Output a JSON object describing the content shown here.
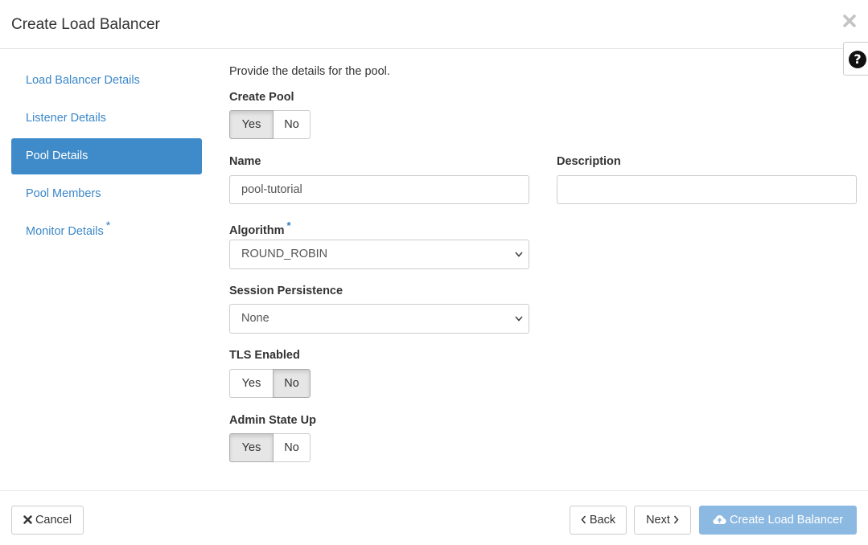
{
  "header": {
    "title": "Create Load Balancer",
    "close_icon": "close-icon",
    "help_icon": "question-circle-icon"
  },
  "sidebar": {
    "items": [
      {
        "label": "Load Balancer Details",
        "active": false,
        "required": false
      },
      {
        "label": "Listener Details",
        "active": false,
        "required": false
      },
      {
        "label": "Pool Details",
        "active": true,
        "required": false
      },
      {
        "label": "Pool Members",
        "active": false,
        "required": false
      },
      {
        "label": "Monitor Details",
        "active": false,
        "required": true,
        "required_mark": "*"
      }
    ]
  },
  "form": {
    "intro": "Provide the details for the pool.",
    "create_pool": {
      "label": "Create Pool",
      "yes": "Yes",
      "no": "No",
      "selected": "Yes"
    },
    "name": {
      "label": "Name",
      "value": "pool-tutorial"
    },
    "description": {
      "label": "Description",
      "value": ""
    },
    "algorithm": {
      "label": "Algorithm",
      "required_mark": "*",
      "value": "ROUND_ROBIN"
    },
    "session_persistence": {
      "label": "Session Persistence",
      "value": "None"
    },
    "tls_enabled": {
      "label": "TLS Enabled",
      "yes": "Yes",
      "no": "No",
      "selected": "No"
    },
    "admin_state_up": {
      "label": "Admin State Up",
      "yes": "Yes",
      "no": "No",
      "selected": "Yes"
    }
  },
  "footer": {
    "cancel_label": "Cancel",
    "back_label": "Back",
    "next_label": "Next",
    "create_label": "Create Load Balancer"
  },
  "colors": {
    "accent": "#3f8ac9",
    "link": "#3b87c8",
    "primary_disabled": "#8cb9e2"
  }
}
